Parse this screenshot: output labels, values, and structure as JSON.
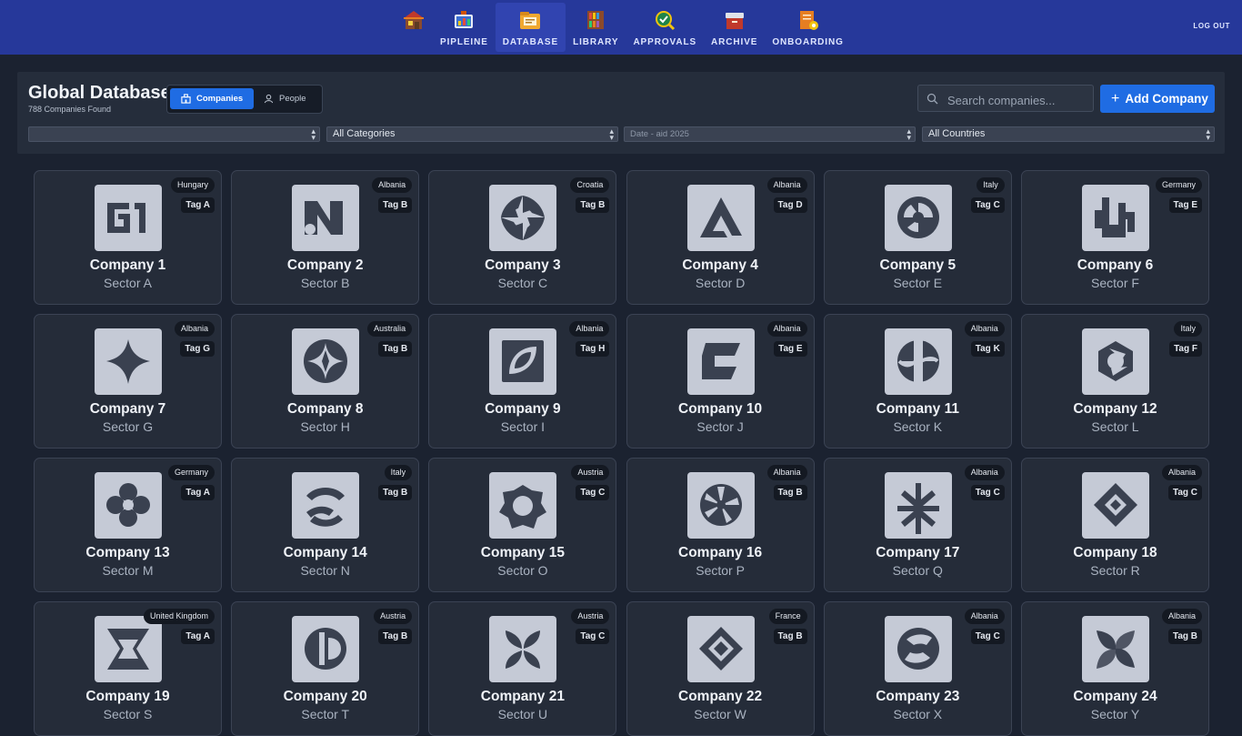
{
  "nav": {
    "items": [
      {
        "key": "home",
        "label": "",
        "icon": "store-icon"
      },
      {
        "key": "pipeline",
        "label": "PIPLEINE",
        "icon": "pipeline-icon"
      },
      {
        "key": "database",
        "label": "DATABASE",
        "icon": "database-icon",
        "active": true
      },
      {
        "key": "library",
        "label": "LIBRARY",
        "icon": "library-icon"
      },
      {
        "key": "approvals",
        "label": "APPROVALS",
        "icon": "approvals-icon"
      },
      {
        "key": "archive",
        "label": "ARCHIVE",
        "icon": "archive-icon"
      },
      {
        "key": "onboarding",
        "label": "ONBOARDING",
        "icon": "onboarding-icon"
      }
    ],
    "logout_label": "LOG OUT"
  },
  "header": {
    "title": "Global Database",
    "count": "788 Companies Found",
    "toggle": {
      "companies": "Companies",
      "people": "People",
      "selected": "Companies"
    },
    "search_placeholder": "Search companies...",
    "add_label": "Add Company"
  },
  "filters": [
    {
      "key": "sector",
      "value": ""
    },
    {
      "key": "category",
      "value": "All Categories"
    },
    {
      "key": "date",
      "value": "Date - aid 2025"
    },
    {
      "key": "country",
      "value": "All Countries"
    }
  ],
  "companies": [
    {
      "name": "Company 1",
      "sector": "Sector A",
      "country": "Hungary",
      "tag": "Tag A",
      "logo": 1
    },
    {
      "name": "Company 2",
      "sector": "Sector B",
      "country": "Albania",
      "tag": "Tag B",
      "logo": 2
    },
    {
      "name": "Company 3",
      "sector": "Sector C",
      "country": "Croatia",
      "tag": "Tag B",
      "logo": 3
    },
    {
      "name": "Company 4",
      "sector": "Sector D",
      "country": "Albania",
      "tag": "Tag D",
      "logo": 4
    },
    {
      "name": "Company 5",
      "sector": "Sector E",
      "country": "Italy",
      "tag": "Tag C",
      "logo": 5
    },
    {
      "name": "Company 6",
      "sector": "Sector F",
      "country": "Germany",
      "tag": "Tag E",
      "logo": 6
    },
    {
      "name": "Company 7",
      "sector": "Sector G",
      "country": "Albania",
      "tag": "Tag G",
      "logo": 7
    },
    {
      "name": "Company 8",
      "sector": "Sector H",
      "country": "Australia",
      "tag": "Tag B",
      "logo": 8
    },
    {
      "name": "Company 9",
      "sector": "Sector I",
      "country": "Albania",
      "tag": "Tag H",
      "logo": 9
    },
    {
      "name": "Company 10",
      "sector": "Sector J",
      "country": "Albania",
      "tag": "Tag E",
      "logo": 10
    },
    {
      "name": "Company 11",
      "sector": "Sector K",
      "country": "Albania",
      "tag": "Tag K",
      "logo": 11
    },
    {
      "name": "Company 12",
      "sector": "Sector L",
      "country": "Italy",
      "tag": "Tag F",
      "logo": 12
    },
    {
      "name": "Company 13",
      "sector": "Sector M",
      "country": "Germany",
      "tag": "Tag A",
      "logo": 13
    },
    {
      "name": "Company 14",
      "sector": "Sector N",
      "country": "Italy",
      "tag": "Tag B",
      "logo": 14
    },
    {
      "name": "Company 15",
      "sector": "Sector O",
      "country": "Austria",
      "tag": "Tag C",
      "logo": 15
    },
    {
      "name": "Company 16",
      "sector": "Sector P",
      "country": "Albania",
      "tag": "Tag B",
      "logo": 16
    },
    {
      "name": "Company 17",
      "sector": "Sector Q",
      "country": "Albania",
      "tag": "Tag C",
      "logo": 17
    },
    {
      "name": "Company 18",
      "sector": "Sector R",
      "country": "Albania",
      "tag": "Tag C",
      "logo": 18
    },
    {
      "name": "Company 19",
      "sector": "Sector S",
      "country": "United Kingdom",
      "tag": "Tag A",
      "logo": 19
    },
    {
      "name": "Company 20",
      "sector": "Sector T",
      "country": "Austria",
      "tag": "Tag B",
      "logo": 20
    },
    {
      "name": "Company 21",
      "sector": "Sector U",
      "country": "Austria",
      "tag": "Tag C",
      "logo": 21
    },
    {
      "name": "Company 22",
      "sector": "Sector W",
      "country": "France",
      "tag": "Tag B",
      "logo": 22
    },
    {
      "name": "Company 23",
      "sector": "Sector X",
      "country": "Albania",
      "tag": "Tag C",
      "logo": 23
    },
    {
      "name": "Company 24",
      "sector": "Sector Y",
      "country": "Albania",
      "tag": "Tag B",
      "logo": 24
    }
  ],
  "colors": {
    "topbar": "#26389a",
    "accent": "#1f6ce3",
    "background": "#1b2230",
    "card": "#252c39",
    "logo_tile": "#c5cad6",
    "logo_mark": "#3a4150"
  }
}
